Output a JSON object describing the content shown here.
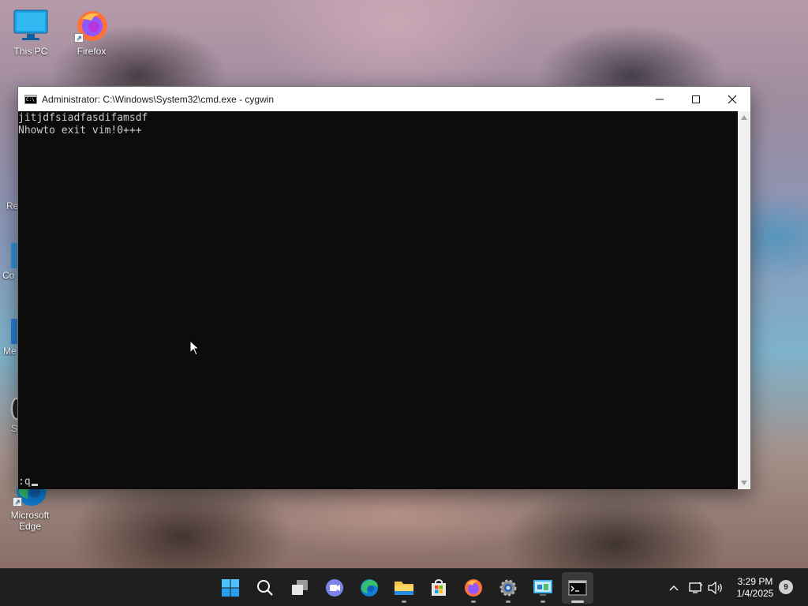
{
  "desktop": {
    "icons": [
      {
        "label": "This PC",
        "icon": "monitor-icon"
      },
      {
        "label": "Firefox",
        "icon": "firefox-icon"
      },
      {
        "label": "Microsoft Edge",
        "icon": "edge-icon"
      }
    ],
    "partial_icons": [
      {
        "label": "Re",
        "icon": "recycle-bin-icon"
      },
      {
        "label": "Co",
        "icon": "control-panel-icon"
      },
      {
        "label": "Me",
        "icon": "app-icon"
      },
      {
        "label": "S",
        "icon": "app-icon"
      }
    ]
  },
  "window": {
    "title": "Administrator: C:\\Windows\\System32\\cmd.exe - cygwin",
    "app_icon_text": "C:\\",
    "console_lines": [
      "jitjdfsiadfasdifamsdf",
      "Nhowto exit vim!0+++"
    ],
    "command_line": ":q"
  },
  "taskbar": {
    "apps": [
      {
        "name": "start",
        "icon": "windows-start-icon"
      },
      {
        "name": "search",
        "icon": "search-icon"
      },
      {
        "name": "task-view",
        "icon": "task-view-icon"
      },
      {
        "name": "teams-chat",
        "icon": "chat-icon"
      },
      {
        "name": "edge",
        "icon": "edge-icon"
      },
      {
        "name": "file-explorer",
        "icon": "folder-icon"
      },
      {
        "name": "store",
        "icon": "store-icon"
      },
      {
        "name": "firefox",
        "icon": "firefox-icon"
      },
      {
        "name": "settings",
        "icon": "gear-icon"
      },
      {
        "name": "control-panel",
        "icon": "control-panel-icon"
      },
      {
        "name": "terminal",
        "icon": "terminal-icon"
      }
    ],
    "clock": {
      "time": "3:29 PM",
      "date": "1/4/2025"
    },
    "notification_count": "9"
  },
  "colors": {
    "console_bg": "#0c0c0c",
    "console_fg": "#cccccc",
    "taskbar_bg": "#1f1f1f",
    "accent": "#0078d4"
  }
}
